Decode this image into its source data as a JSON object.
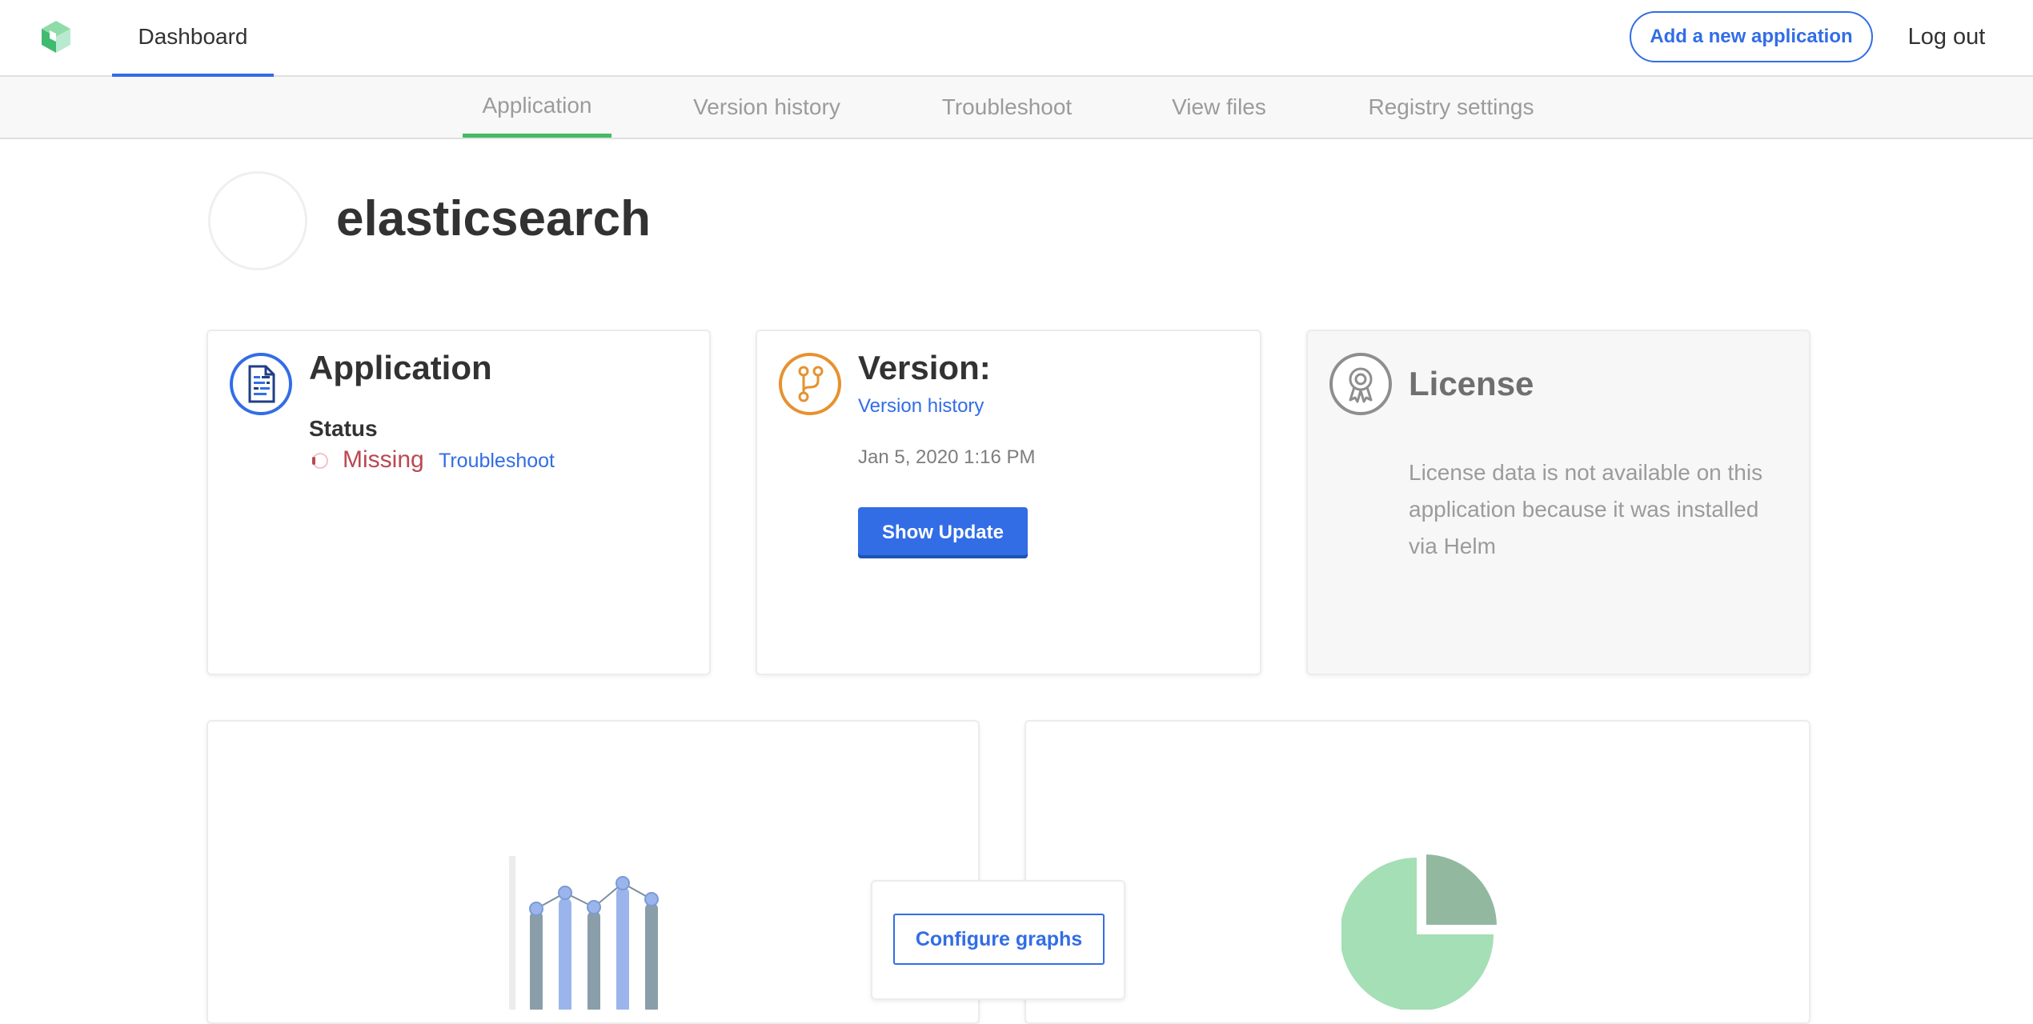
{
  "navbar": {
    "logo_icon": "replicated-cube-logo",
    "dashboard_label": "Dashboard",
    "add_app_label": "Add a new application",
    "logout_label": "Log out"
  },
  "subnav": {
    "tabs": [
      {
        "label": "Application",
        "active": true
      },
      {
        "label": "Version history",
        "active": false
      },
      {
        "label": "Troubleshoot",
        "active": false
      },
      {
        "label": "View files",
        "active": false
      },
      {
        "label": "Registry settings",
        "active": false
      }
    ]
  },
  "app": {
    "name": "elasticsearch"
  },
  "application_card": {
    "icon": "document-icon",
    "title": "Application",
    "status_label": "Status",
    "status_value": "Missing",
    "troubleshoot_link": "Troubleshoot"
  },
  "version_card": {
    "icon": "git-branch-icon",
    "title": "Version:",
    "version_history_link": "Version history",
    "date": "Jan 5, 2020 1:16 PM",
    "show_update_label": "Show Update"
  },
  "license_card": {
    "icon": "license-badge-icon",
    "title": "License",
    "message": "License data is not available on this application because it was installed via Helm"
  },
  "graphs": {
    "configure_label": "Configure graphs"
  },
  "colors": {
    "accent_blue": "#326de6",
    "active_tab_green": "#44bb66",
    "status_missing_red": "#bc4752",
    "version_orange": "#e6922f",
    "pie_light_green": "#a4dfb5",
    "pie_dark_green": "#93b8a0"
  }
}
